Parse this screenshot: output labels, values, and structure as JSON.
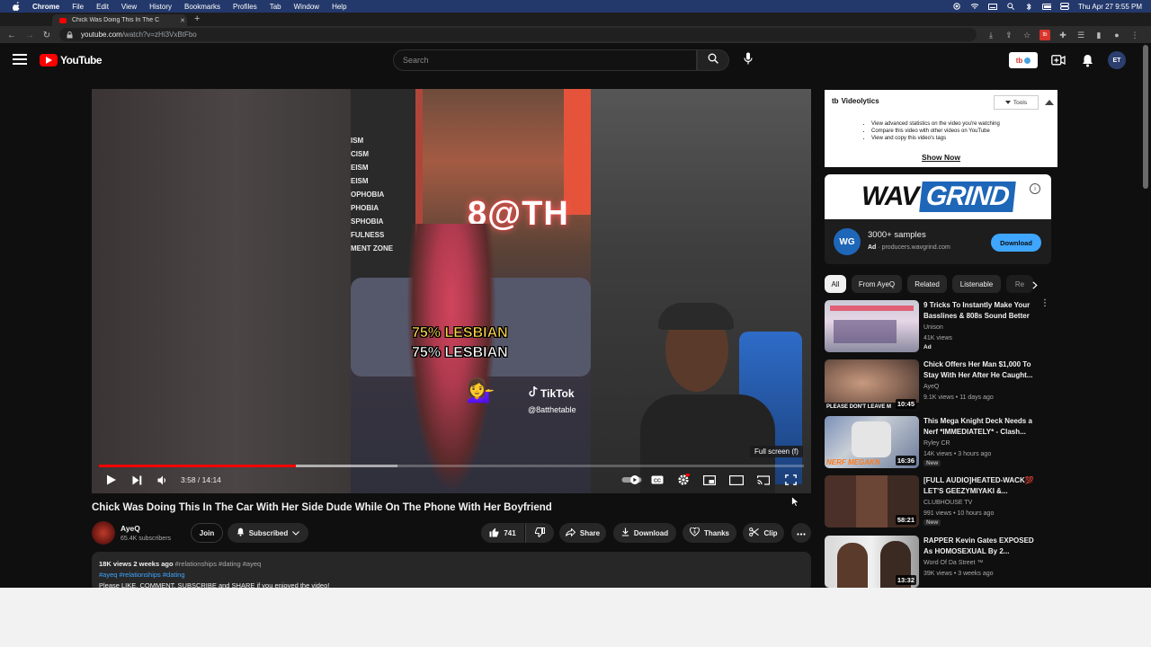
{
  "menubar": {
    "app": "Chrome",
    "items": [
      "File",
      "Edit",
      "View",
      "History",
      "Bookmarks",
      "Profiles",
      "Tab",
      "Window",
      "Help"
    ],
    "clock": "Thu Apr 27  9:55 PM"
  },
  "browser": {
    "tab_title": "Chick Was Doing This In The C",
    "url_host": "youtube.com",
    "url_path": "/watch?v=zHi3VxBtFbo"
  },
  "masthead": {
    "logo_text": "YouTube",
    "search_placeholder": "Search",
    "tb_badge": "tb",
    "avatar_initials": "ET"
  },
  "player": {
    "current_time": "3:58",
    "duration": "14:14",
    "time_display": "3:58 / 14:14",
    "progress": 0.279,
    "fullscreen_tooltip": "Full screen (f)",
    "overlay": {
      "wall_words": [
        "ISM",
        "CISM",
        "EISM",
        "EISM",
        "OPHOBIA",
        "PHOBIA",
        "SPHOBIA",
        "FULNESS",
        "MENT ZONE"
      ],
      "neon_text": "8@TH",
      "caption1": "75% LESBIAN",
      "caption2": "75% LESBIAN",
      "emoji": "💁‍♀️",
      "tiktok_label": "TikTok",
      "tiktok_handle": "@8atthetable"
    }
  },
  "video": {
    "title": "Chick Was Doing This In The Car With Her Side Dude While On The Phone With Her Boyfriend",
    "channel": "AyeQ",
    "subscribers": "65.4K subscribers",
    "join_label": "Join",
    "subscribed_label": "Subscribed",
    "likes": "741",
    "share_label": "Share",
    "download_label": "Download",
    "thanks_label": "Thanks",
    "clip_label": "Clip"
  },
  "description": {
    "views": "18K views",
    "age": "2 weeks ago",
    "inline_tags": "#relationships #dating #ayeq",
    "tags": "#ayeq  #relationships  #dating",
    "text": "Please LIKE, COMMENT, SUBSCRIBE and SHARE if you enjoyed the video!"
  },
  "videolytics": {
    "title": "Videolytics",
    "tools_label": "Tools",
    "bullets": [
      "View advanced statistics on the video you're watching",
      "Compare this video with other videos on YouTube",
      "View and copy this video's tags"
    ],
    "cta": "Show Now"
  },
  "ad": {
    "brand_left": "WAV",
    "brand_right": "GRIND",
    "logo_initials": "WG",
    "headline": "3000+ samples",
    "ad_label": "Ad",
    "domain": "producers.wavgrind.com",
    "cta": "Download"
  },
  "chips": [
    "All",
    "From AyeQ",
    "Related",
    "Listenable",
    "Re"
  ],
  "recommendations": [
    {
      "title": "9 Tricks To Instantly Make Your Basslines & 808s Sound Better",
      "channel": "Unison",
      "views": "41K views",
      "badge": "Ad",
      "duration": ""
    },
    {
      "title": "Chick Offers Her Man $1,000 To Stay With Her After He Caught...",
      "channel": "AyeQ",
      "views": "9.1K views • 11 days ago",
      "badge": "",
      "duration": "10:45"
    },
    {
      "title": "This Mega Knight Deck Needs a Nerf *IMMEDIATELY* - Clash...",
      "channel": "Ryley CR",
      "views": "14K views • 3 hours ago",
      "badge": "New",
      "duration": "16:36"
    },
    {
      "title": "[FULL AUDIO]HEATED-WACK💯 LET'S GEEZYMIYAKI &...",
      "channel": "CLUBHOUSE TV",
      "views": "991 views • 10 hours ago",
      "badge": "New",
      "duration": "58:21"
    },
    {
      "title": "RAPPER Kevin Gates EXPOSED As HOMOSEXUAL By 2...",
      "channel": "Word Of Da Street ™",
      "views": "39K views • 3 weeks ago",
      "badge": "",
      "duration": "13:32"
    }
  ],
  "colors": {
    "yt_red": "#ff0000",
    "link_blue": "#3ea6ff",
    "bg": "#0f0f0f",
    "menubar": "#23386b"
  }
}
